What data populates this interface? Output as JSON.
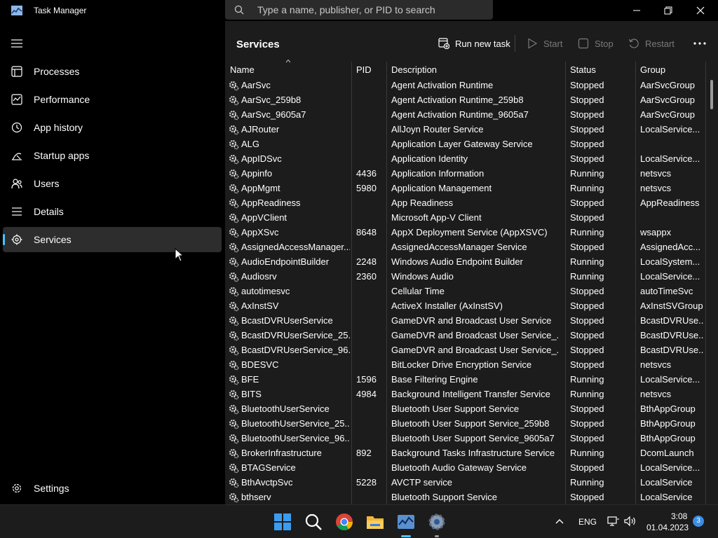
{
  "window": {
    "title": "Task Manager",
    "search_placeholder": "Type a name, publisher, or PID to search"
  },
  "sidebar": {
    "menu_icon": "hamburger-icon",
    "items": [
      {
        "label": "Processes",
        "icon": "processes-icon"
      },
      {
        "label": "Performance",
        "icon": "performance-icon"
      },
      {
        "label": "App history",
        "icon": "app-history-icon"
      },
      {
        "label": "Startup apps",
        "icon": "startup-apps-icon"
      },
      {
        "label": "Users",
        "icon": "users-icon"
      },
      {
        "label": "Details",
        "icon": "details-icon"
      },
      {
        "label": "Services",
        "icon": "services-icon",
        "selected": true
      }
    ],
    "settings": {
      "label": "Settings",
      "icon": "gear-icon"
    }
  },
  "main": {
    "title": "Services",
    "toolbar": {
      "run_new_task": "Run new task",
      "start": "Start",
      "stop": "Stop",
      "restart": "Restart"
    },
    "columns": [
      "Name",
      "PID",
      "Description",
      "Status",
      "Group"
    ],
    "rows": [
      {
        "name": "AarSvc",
        "pid": "",
        "desc": "Agent Activation Runtime",
        "status": "Stopped",
        "group": "AarSvcGroup"
      },
      {
        "name": "AarSvc_259b8",
        "pid": "",
        "desc": "Agent Activation Runtime_259b8",
        "status": "Stopped",
        "group": "AarSvcGroup"
      },
      {
        "name": "AarSvc_9605a7",
        "pid": "",
        "desc": "Agent Activation Runtime_9605a7",
        "status": "Stopped",
        "group": "AarSvcGroup"
      },
      {
        "name": "AJRouter",
        "pid": "",
        "desc": "AllJoyn Router Service",
        "status": "Stopped",
        "group": "LocalService..."
      },
      {
        "name": "ALG",
        "pid": "",
        "desc": "Application Layer Gateway Service",
        "status": "Stopped",
        "group": ""
      },
      {
        "name": "AppIDSvc",
        "pid": "",
        "desc": "Application Identity",
        "status": "Stopped",
        "group": "LocalService..."
      },
      {
        "name": "Appinfo",
        "pid": "4436",
        "desc": "Application Information",
        "status": "Running",
        "group": "netsvcs"
      },
      {
        "name": "AppMgmt",
        "pid": "5980",
        "desc": "Application Management",
        "status": "Running",
        "group": "netsvcs"
      },
      {
        "name": "AppReadiness",
        "pid": "",
        "desc": "App Readiness",
        "status": "Stopped",
        "group": "AppReadiness"
      },
      {
        "name": "AppVClient",
        "pid": "",
        "desc": "Microsoft App-V Client",
        "status": "Stopped",
        "group": ""
      },
      {
        "name": "AppXSvc",
        "pid": "8648",
        "desc": "AppX Deployment Service (AppXSVC)",
        "status": "Running",
        "group": "wsappx"
      },
      {
        "name": "AssignedAccessManager...",
        "pid": "",
        "desc": "AssignedAccessManager Service",
        "status": "Stopped",
        "group": "AssignedAcc..."
      },
      {
        "name": "AudioEndpointBuilder",
        "pid": "2248",
        "desc": "Windows Audio Endpoint Builder",
        "status": "Running",
        "group": "LocalSystem..."
      },
      {
        "name": "Audiosrv",
        "pid": "2360",
        "desc": "Windows Audio",
        "status": "Running",
        "group": "LocalService..."
      },
      {
        "name": "autotimesvc",
        "pid": "",
        "desc": "Cellular Time",
        "status": "Stopped",
        "group": "autoTimeSvc"
      },
      {
        "name": "AxInstSV",
        "pid": "",
        "desc": "ActiveX Installer (AxInstSV)",
        "status": "Stopped",
        "group": "AxInstSVGroup"
      },
      {
        "name": "BcastDVRUserService",
        "pid": "",
        "desc": "GameDVR and Broadcast User Service",
        "status": "Stopped",
        "group": "BcastDVRUse..."
      },
      {
        "name": "BcastDVRUserService_25...",
        "pid": "",
        "desc": "GameDVR and Broadcast User Service_...",
        "status": "Stopped",
        "group": "BcastDVRUse..."
      },
      {
        "name": "BcastDVRUserService_96...",
        "pid": "",
        "desc": "GameDVR and Broadcast User Service_...",
        "status": "Stopped",
        "group": "BcastDVRUse..."
      },
      {
        "name": "BDESVC",
        "pid": "",
        "desc": "BitLocker Drive Encryption Service",
        "status": "Stopped",
        "group": "netsvcs"
      },
      {
        "name": "BFE",
        "pid": "1596",
        "desc": "Base Filtering Engine",
        "status": "Running",
        "group": "LocalService..."
      },
      {
        "name": "BITS",
        "pid": "4984",
        "desc": "Background Intelligent Transfer Service",
        "status": "Running",
        "group": "netsvcs"
      },
      {
        "name": "BluetoothUserService",
        "pid": "",
        "desc": "Bluetooth User Support Service",
        "status": "Stopped",
        "group": "BthAppGroup"
      },
      {
        "name": "BluetoothUserService_25...",
        "pid": "",
        "desc": "Bluetooth User Support Service_259b8",
        "status": "Stopped",
        "group": "BthAppGroup"
      },
      {
        "name": "BluetoothUserService_96...",
        "pid": "",
        "desc": "Bluetooth User Support Service_9605a7",
        "status": "Stopped",
        "group": "BthAppGroup"
      },
      {
        "name": "BrokerInfrastructure",
        "pid": "892",
        "desc": "Background Tasks Infrastructure Service",
        "status": "Running",
        "group": "DcomLaunch"
      },
      {
        "name": "BTAGService",
        "pid": "",
        "desc": "Bluetooth Audio Gateway Service",
        "status": "Stopped",
        "group": "LocalService..."
      },
      {
        "name": "BthAvctpSvc",
        "pid": "5228",
        "desc": "AVCTP service",
        "status": "Running",
        "group": "LocalService"
      },
      {
        "name": "bthserv",
        "pid": "",
        "desc": "Bluetooth Support Service",
        "status": "Stopped",
        "group": "LocalService"
      }
    ]
  },
  "taskbar": {
    "apps": [
      "windows-start-icon",
      "search-icon",
      "chrome-icon",
      "file-explorer-icon",
      "task-manager-icon",
      "settings-icon"
    ],
    "language": "ENG",
    "time": "3:08",
    "date": "01.04.2023",
    "notifications": "3"
  },
  "colors": {
    "accent": "#4cc2ff",
    "panel": "#1c1c1c",
    "sidebar": "#000000"
  }
}
